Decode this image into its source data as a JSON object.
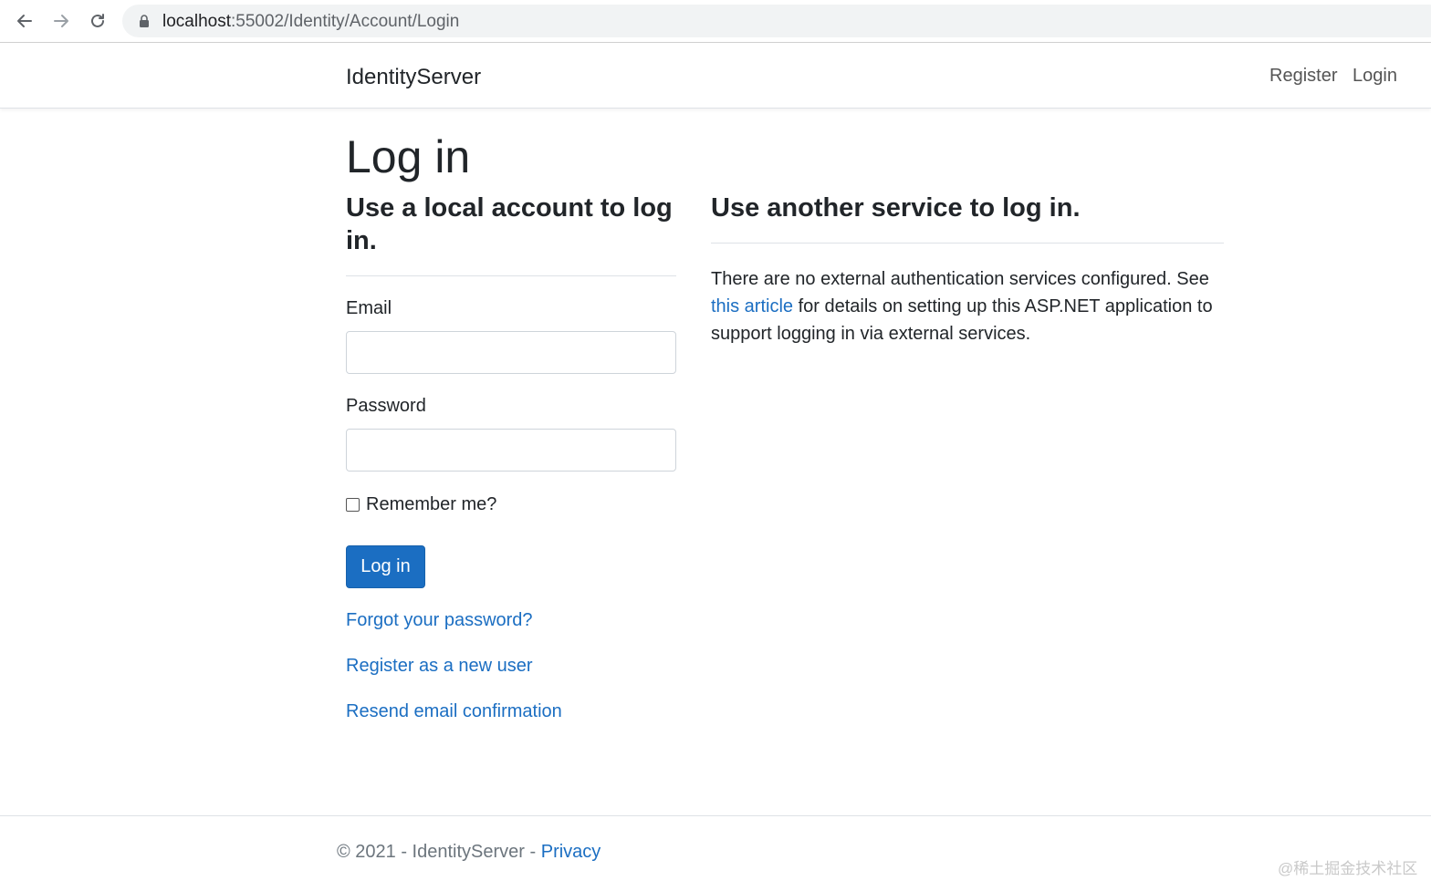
{
  "browser": {
    "url_host": "localhost",
    "url_path": ":55002/Identity/Account/Login"
  },
  "navbar": {
    "brand": "IdentityServer",
    "register": "Register",
    "login": "Login"
  },
  "main": {
    "title": "Log in",
    "local": {
      "heading": "Use a local account to log in.",
      "email_label": "Email",
      "email_value": "",
      "password_label": "Password",
      "password_value": "",
      "remember_label": "Remember me?",
      "remember_checked": false,
      "submit_label": "Log in",
      "forgot_link": "Forgot your password?",
      "register_link": "Register as a new user",
      "resend_link": "Resend email confirmation"
    },
    "external": {
      "heading": "Use another service to log in.",
      "text_before": "There are no external authentication services configured. See ",
      "link_text": "this article",
      "text_after": " for details on setting up this ASP.NET application to support logging in via external services."
    }
  },
  "footer": {
    "text": "© 2021 - IdentityServer - ",
    "privacy": "Privacy"
  },
  "watermark": "@稀土掘金技术社区",
  "colors": {
    "primary": "#1b6ec2",
    "link": "#1b6ec2",
    "text": "#212529"
  }
}
